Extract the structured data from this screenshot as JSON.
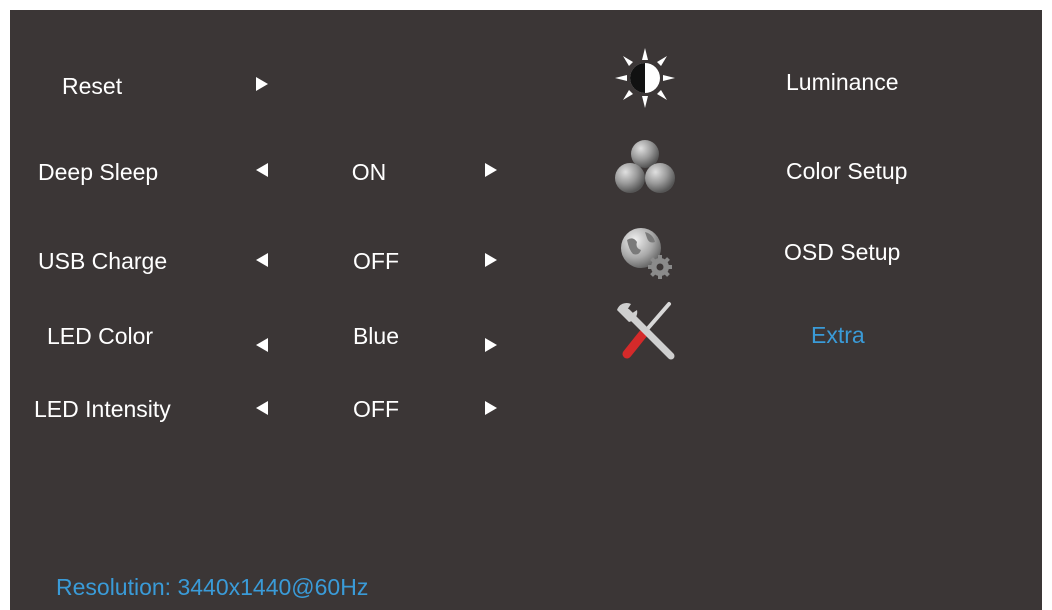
{
  "settings": {
    "reset_label": "Reset",
    "deep_sleep": {
      "label": "Deep Sleep",
      "value": "ON"
    },
    "usb_charge": {
      "label": "USB Charge",
      "value": "OFF"
    },
    "led_color": {
      "label": "LED Color",
      "value": "Blue"
    },
    "led_intensity": {
      "label": "LED Intensity",
      "value": "OFF"
    }
  },
  "nav": {
    "luminance": "Luminance",
    "color_setup": "Color Setup",
    "osd_setup": "OSD Setup",
    "extra": "Extra",
    "active": "Extra"
  },
  "icons": {
    "luminance": "brightness-contrast-icon",
    "color_setup": "color-spheres-icon",
    "osd_setup": "globe-gear-icon",
    "extra": "wrench-screwdriver-icon"
  },
  "status": {
    "resolution": "Resolution: 3440x1440@60Hz"
  },
  "colors": {
    "background": "#3b3636",
    "text": "#ffffff",
    "accent": "#3a9bd8"
  }
}
